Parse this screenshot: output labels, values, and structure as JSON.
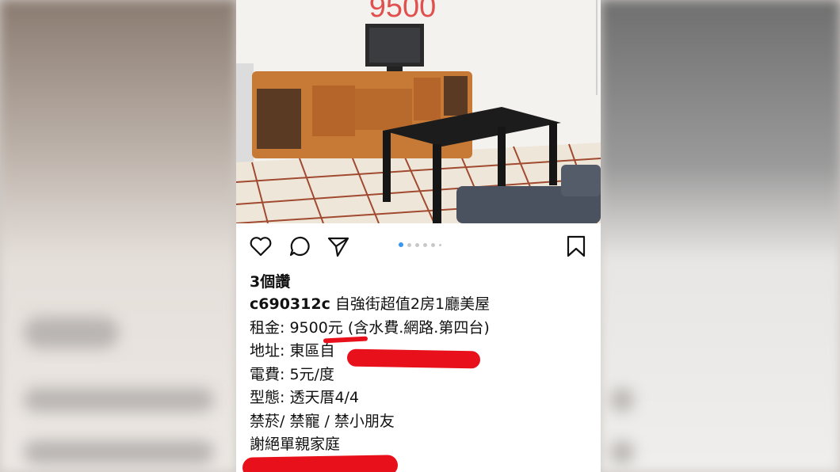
{
  "overlay_price": "9500",
  "post": {
    "likes": "3個讚",
    "username": "c690312c",
    "title": "自強街超值2房1廳美屋",
    "lines": [
      "租金: 9500元 (含水費.網路.第四台)",
      "地址: 東區自",
      "電費: 5元/度",
      "型態: 透天厝4/4",
      "禁菸/ 禁寵 / 禁小朋友",
      "謝絕單親家庭"
    ]
  },
  "icons": {
    "like": "heart-icon",
    "comment": "comment-icon",
    "share": "send-icon",
    "save": "bookmark-icon"
  },
  "carousel": {
    "count": 6,
    "active": 1
  },
  "colors": {
    "accent": "#3897f0",
    "redaction": "#e8101a",
    "price": "#e0504f"
  }
}
